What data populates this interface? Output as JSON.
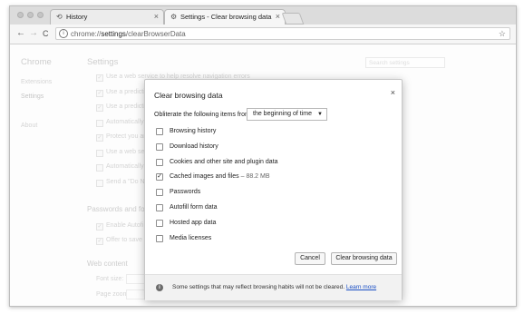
{
  "browser": {
    "tabs": [
      {
        "label": "History",
        "icon": "history-icon"
      },
      {
        "label": "Settings - Clear browsing data",
        "icon": "gear-icon"
      }
    ],
    "close_glyph": "×",
    "nav": {
      "back": "←",
      "forward": "→",
      "reload": "C"
    },
    "url_prefix": "chrome://",
    "url_host": "settings",
    "url_path": "/clearBrowserData",
    "star": "☆",
    "info_glyph": "i"
  },
  "settings_bg": {
    "app_title": "Chrome",
    "sidebar": [
      "Extensions",
      "Settings",
      "About"
    ],
    "page_title": "Settings",
    "search_placeholder": "Search settings",
    "privacy_rows": [
      {
        "text": "Use a web service to help resolve navigation errors",
        "checked": true
      },
      {
        "text": "Use a predicti",
        "checked": true
      },
      {
        "text": "Use a predicti",
        "checked": true
      },
      {
        "text": "Automatically",
        "checked": false
      },
      {
        "text": "Protect you ar",
        "checked": true
      },
      {
        "text": "Use a web ser",
        "checked": false
      },
      {
        "text": "Automatically",
        "checked": false
      },
      {
        "text": "Send a \"Do Ne",
        "checked": false
      }
    ],
    "passwords_heading": "Passwords and fo",
    "passwords_rows": [
      {
        "text": "Enable Autofi",
        "checked": true
      },
      {
        "text": "Offer to save y",
        "checked": true
      }
    ],
    "web_content_heading": "Web content",
    "font_size_label": "Font size:",
    "page_zoom_label": "Page zoom:"
  },
  "dialog": {
    "title": "Clear browsing data",
    "close": "×",
    "obliterate_label": "Obliterate the following items from:",
    "time_range": "the beginning of time",
    "items": [
      {
        "label": "Browsing history",
        "checked": false
      },
      {
        "label": "Download history",
        "checked": false
      },
      {
        "label": "Cookies and other site and plugin data",
        "checked": false
      },
      {
        "label": "Cached images and files",
        "extra": "88.2 MB",
        "checked": true
      },
      {
        "label": "Passwords",
        "checked": false
      },
      {
        "label": "Autofill form data",
        "checked": false
      },
      {
        "label": "Hosted app data",
        "checked": false
      },
      {
        "label": "Media licenses",
        "checked": false
      }
    ],
    "check_glyph": "✓",
    "cancel_label": "Cancel",
    "clear_label": "Clear browsing data",
    "footer_text": "Some settings that may reflect browsing habits will not be cleared.",
    "learn_more": "Learn more"
  }
}
